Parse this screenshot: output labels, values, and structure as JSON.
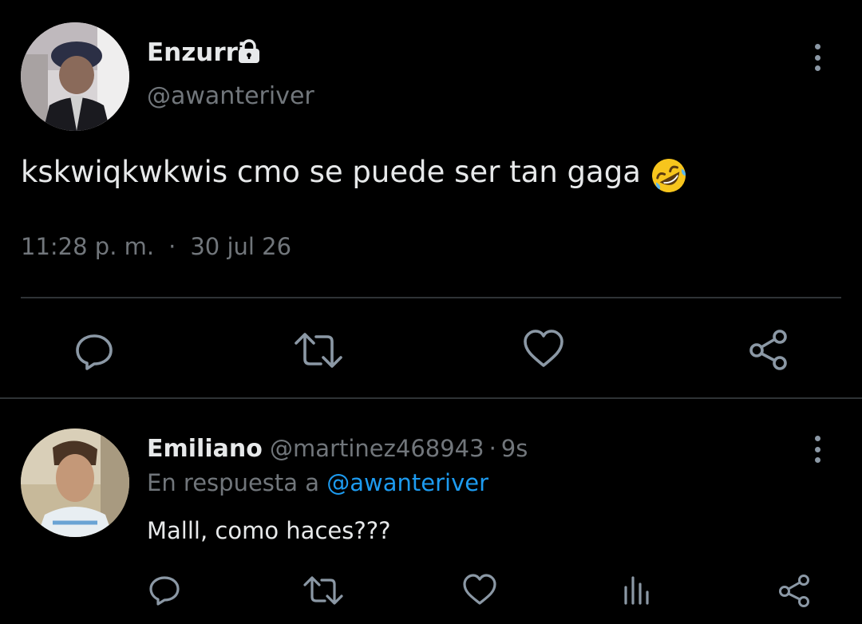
{
  "tweet": {
    "author_name": "Enzurri",
    "author_handle": "@awanteriver",
    "text": "kskwiqkwkwis cmo se puede ser tan gaga",
    "emoji": "rolling-on-floor-laughing-emoji",
    "time": "11:28 p. m.",
    "separator": "·",
    "date": "30 jul 26",
    "locked": true
  },
  "reply": {
    "author_name": "Emiliano",
    "author_handle": "@martinez468943",
    "separator": "·",
    "time": "9s",
    "replying_prefix": "En respuesta a",
    "replying_to": "@awanteriver",
    "text": "Malll, como haces???"
  },
  "icons": {
    "main_actions": [
      "reply-icon",
      "retweet-icon",
      "like-icon",
      "share-icon"
    ],
    "reply_actions": [
      "reply-icon",
      "retweet-icon",
      "like-icon",
      "stats-icon",
      "share-icon"
    ],
    "menu": "more-options-icon",
    "lock": "lock-icon"
  },
  "colors": {
    "background": "#000000",
    "text_primary": "#e7e9ea",
    "text_secondary": "#71767b",
    "link": "#1d9bf0",
    "divider": "#2f3336",
    "icon": "#8b98a5"
  }
}
